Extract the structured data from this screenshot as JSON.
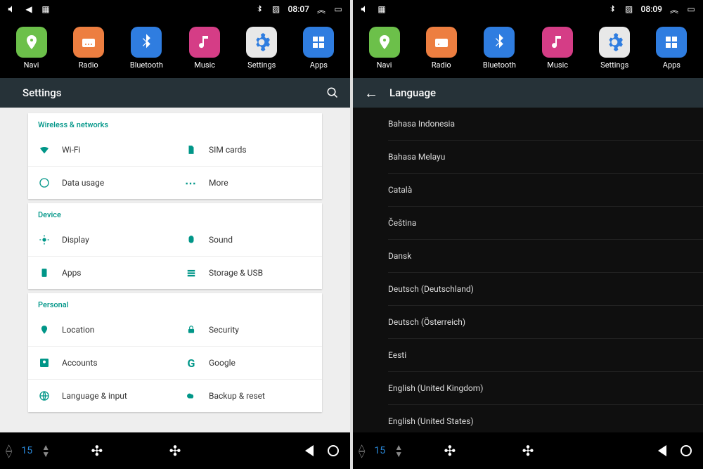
{
  "left": {
    "time": "08:07",
    "launcher": [
      {
        "label": "Navi"
      },
      {
        "label": "Radio"
      },
      {
        "label": "Bluetooth"
      },
      {
        "label": "Music"
      },
      {
        "label": "Settings"
      },
      {
        "label": "Apps"
      }
    ],
    "header_title": "Settings",
    "sections": [
      {
        "title": "Wireless & networks",
        "items": [
          {
            "label": "Wi-Fi",
            "icon": "wifi"
          },
          {
            "label": "SIM cards",
            "icon": "sim"
          },
          {
            "label": "Data usage",
            "icon": "data"
          },
          {
            "label": "More",
            "icon": "more"
          }
        ]
      },
      {
        "title": "Device",
        "items": [
          {
            "label": "Display",
            "icon": "display"
          },
          {
            "label": "Sound",
            "icon": "sound"
          },
          {
            "label": "Apps",
            "icon": "apps"
          },
          {
            "label": "Storage & USB",
            "icon": "storage"
          }
        ]
      },
      {
        "title": "Personal",
        "items": [
          {
            "label": "Location",
            "icon": "location"
          },
          {
            "label": "Security",
            "icon": "security"
          },
          {
            "label": "Accounts",
            "icon": "accounts"
          },
          {
            "label": "Google",
            "icon": "google"
          },
          {
            "label": "Language & input",
            "icon": "language"
          },
          {
            "label": "Backup & reset",
            "icon": "backup"
          }
        ]
      }
    ],
    "temp": "15"
  },
  "right": {
    "time": "08:09",
    "launcher": [
      {
        "label": "Navi"
      },
      {
        "label": "Radio"
      },
      {
        "label": "Bluetooth"
      },
      {
        "label": "Music"
      },
      {
        "label": "Settings"
      },
      {
        "label": "Apps"
      }
    ],
    "header_title": "Language",
    "languages": [
      "Bahasa Indonesia",
      "Bahasa Melayu",
      "Català",
      "Čeština",
      "Dansk",
      "Deutsch (Deutschland)",
      "Deutsch (Österreich)",
      "Eesti",
      "English (United Kingdom)",
      "English (United States)"
    ],
    "temp": "15"
  }
}
